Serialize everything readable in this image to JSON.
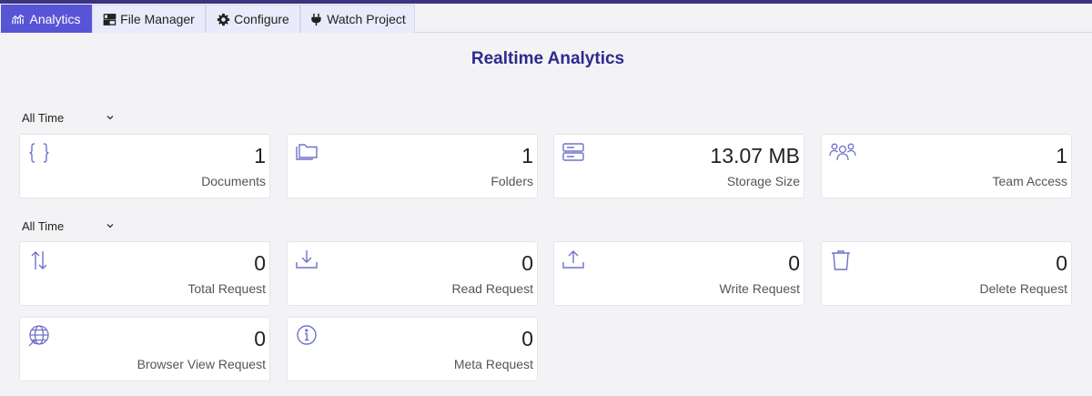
{
  "tabs": [
    {
      "label": "Analytics",
      "icon": "analytics-chart-icon",
      "active": true
    },
    {
      "label": "File Manager",
      "icon": "file-manager-icon",
      "active": false
    },
    {
      "label": "Configure",
      "icon": "gear-icon",
      "active": false
    },
    {
      "label": "Watch Project",
      "icon": "plug-icon",
      "active": false
    }
  ],
  "page_title": "Realtime Analytics",
  "filters": [
    {
      "selected": "All Time"
    },
    {
      "selected": "All Time"
    }
  ],
  "storage_cards": [
    {
      "value": "1",
      "label": "Documents",
      "icon": "braces-icon"
    },
    {
      "value": "1",
      "label": "Folders",
      "icon": "folder-icon"
    },
    {
      "value": "13.07 MB",
      "label": "Storage Size",
      "icon": "server-icon"
    },
    {
      "value": "1",
      "label": "Team Access",
      "icon": "team-icon"
    }
  ],
  "request_cards": [
    {
      "value": "0",
      "label": "Total Request",
      "icon": "up-down-arrows-icon"
    },
    {
      "value": "0",
      "label": "Read Request",
      "icon": "download-icon"
    },
    {
      "value": "0",
      "label": "Write Request",
      "icon": "upload-icon"
    },
    {
      "value": "0",
      "label": "Delete Request",
      "icon": "trash-icon"
    },
    {
      "value": "0",
      "label": "Browser View Request",
      "icon": "globe-icon"
    },
    {
      "value": "0",
      "label": "Meta Request",
      "icon": "info-icon"
    }
  ],
  "colors": {
    "accent": "#5754d6",
    "title": "#2e2a8f",
    "icon": "#6f72c9",
    "tab_bg": "#e9ebfb",
    "page_bg": "#f3f3f5"
  }
}
